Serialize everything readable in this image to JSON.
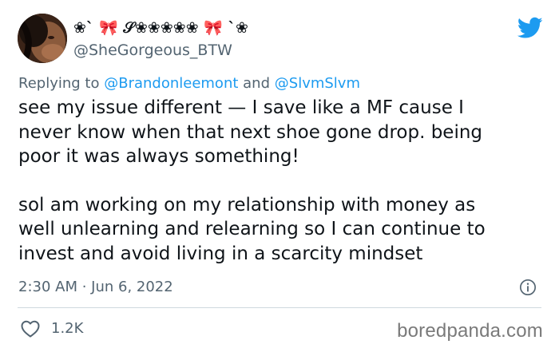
{
  "tweet": {
    "author": {
      "display_name": "❀` 🎀 𝒮❀❀❀❀❀ 🎀 `❀",
      "handle": "@SheGorgeous_BTW"
    },
    "reply_to": {
      "prefix": "Replying to",
      "mention_1": "@Brandonleemont",
      "conjunction": "and",
      "mention_2": "@SlvmSlvm"
    },
    "paragraphs": [
      "see my issue different — I save like a MF cause I\nnever know when that next shoe gone drop. being\npoor it was always something!",
      "sol am working on my relationship with money as\nwell unlearning and relearning so I can continue to\ninvest and avoid living in a scarcity mindset"
    ],
    "timestamp": "2:30 AM · Jun 6, 2022",
    "likes": "1.2K"
  },
  "watermark": "boredpanda.com",
  "icons": {
    "brand": "twitter-logo-icon",
    "info": "info-icon",
    "like": "heart-icon"
  },
  "colors": {
    "twitter_blue": "#1d9bf0",
    "text_primary": "#0f1419",
    "text_secondary": "#536471",
    "divider": "#cfd9de"
  }
}
